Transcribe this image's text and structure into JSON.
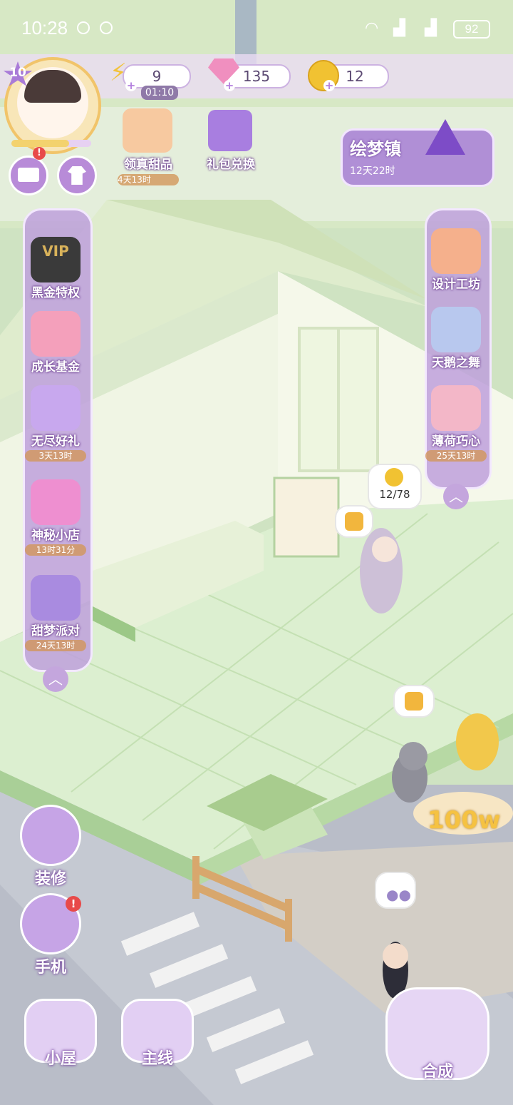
{
  "status_bar": {
    "time": "10:28",
    "battery": "92"
  },
  "player": {
    "level": "10"
  },
  "resources": [
    {
      "name": "energy",
      "value": "9",
      "icon": "lightning-icon",
      "timer": "01:10"
    },
    {
      "name": "gems",
      "value": "135",
      "icon": "diamond-icon"
    },
    {
      "name": "coins",
      "value": "12",
      "icon": "coin-icon"
    }
  ],
  "events_top": [
    {
      "label": "领真甜品",
      "timer": "4天13时"
    },
    {
      "label": "礼包兑换"
    }
  ],
  "dream_town": {
    "label": "绘梦镇",
    "timer": "12天22时"
  },
  "left_menu": [
    {
      "label": "黑金特权",
      "badge": "VIP"
    },
    {
      "label": "成长基金"
    },
    {
      "label": "无尽好礼",
      "timer": "3天13时"
    },
    {
      "label": "神秘小店",
      "timer": "13时31分"
    },
    {
      "label": "甜梦派对",
      "timer": "24天13时"
    }
  ],
  "right_menu": [
    {
      "label": "设计工坊"
    },
    {
      "label": "天鹅之舞"
    },
    {
      "label": "薄荷巧心",
      "timer": "25天13时"
    }
  ],
  "scene": {
    "coin_progress": "12/78",
    "fountain_label": "100w"
  },
  "tools": [
    {
      "label": "装修"
    },
    {
      "label": "手机"
    }
  ],
  "bottom_nav": [
    {
      "label": "小屋"
    },
    {
      "label": "主线"
    },
    {
      "label": "合成"
    }
  ],
  "colors": {
    "accent": "#b88bd8",
    "panel": "#c4a6dd",
    "floor": "#d8eccb",
    "timer": "#d49a5e"
  }
}
